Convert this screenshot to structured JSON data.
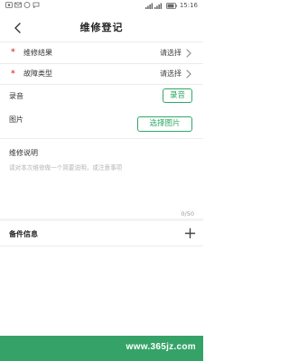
{
  "status_bar": {
    "time": "15:16"
  },
  "header": {
    "title": "维修登记"
  },
  "form": {
    "repair_result": {
      "label": "维修结果",
      "value": "请选择"
    },
    "fault_type": {
      "label": "故障类型",
      "value": "请选择"
    },
    "recording": {
      "label": "录音",
      "button": "录音"
    },
    "picture": {
      "label": "图片",
      "button": "选择图片"
    }
  },
  "description": {
    "title": "维修说明",
    "placeholder": "请对本次维修做一个简要说明，或注意事项",
    "counter": "0/50"
  },
  "parts": {
    "title": "备件信息"
  },
  "footer": {
    "watermark": "www.365jz.com"
  },
  "colors": {
    "accent": "#2fa866",
    "required": "#e0463c",
    "footer": "#35a367"
  },
  "icons": {
    "back": "back-arrow-icon",
    "chevron": "chevron-right-icon",
    "add": "plus-icon"
  }
}
